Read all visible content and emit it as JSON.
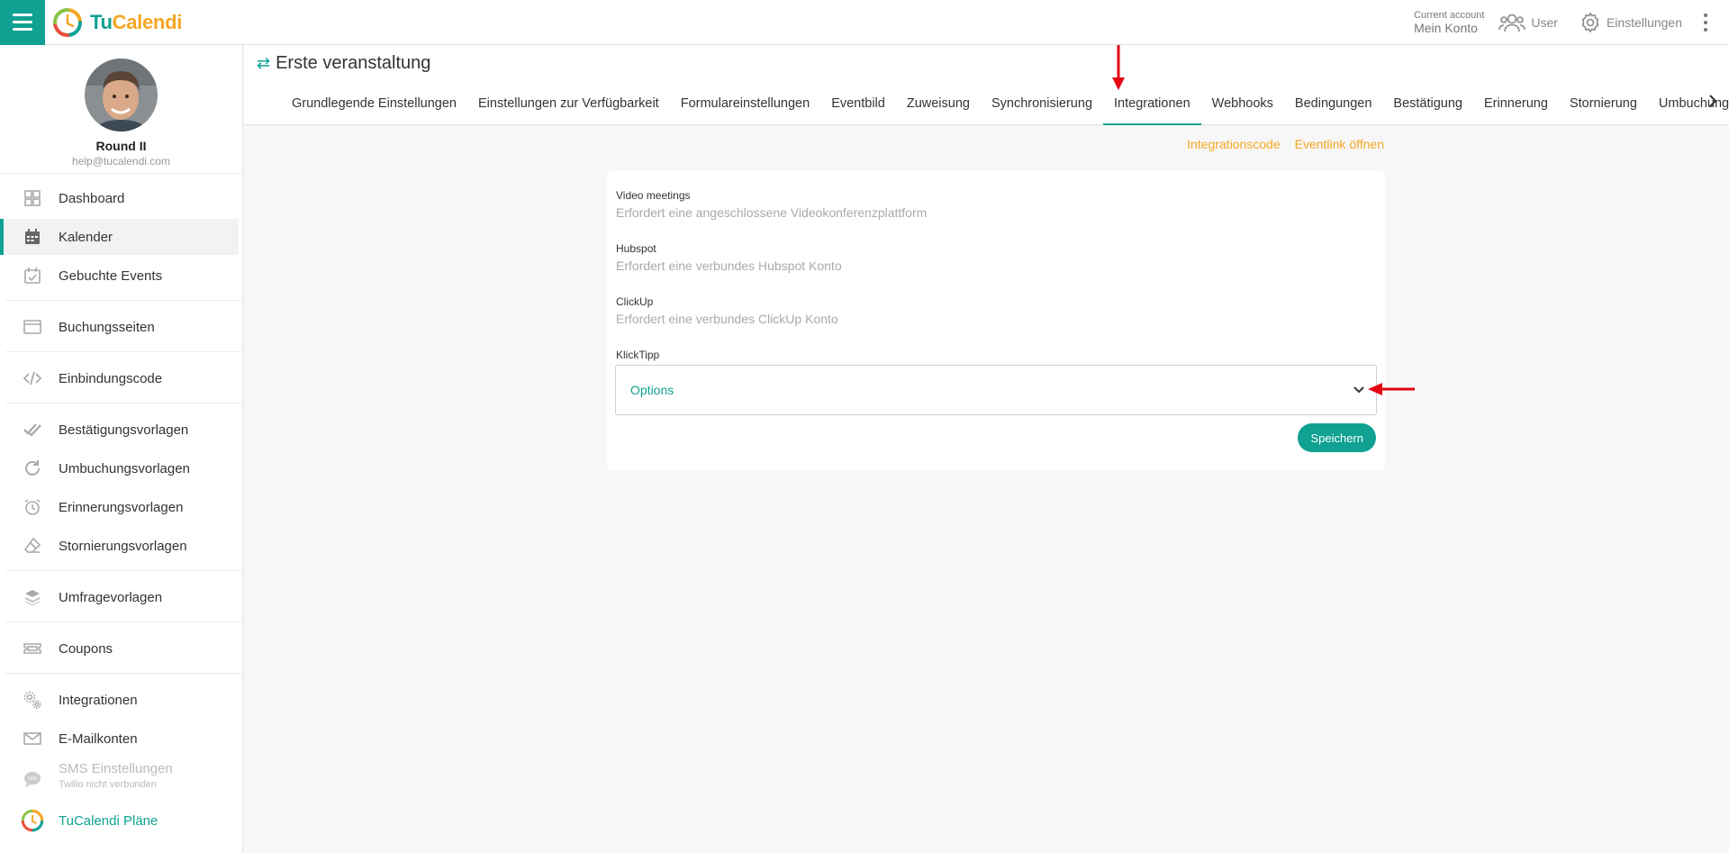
{
  "brand": {
    "name_part1": "Tu",
    "name_part2": "Calendi",
    "accent_color": "#10a192",
    "secondary_color": "#f5a623"
  },
  "topbar": {
    "account_small": "Current account",
    "account_main": "Mein Konto",
    "user_label": "User",
    "settings_label": "Einstellungen"
  },
  "profile": {
    "name": "Round II",
    "email": "help@tucalendi.com"
  },
  "sidebar": {
    "items": [
      {
        "label": "Dashboard",
        "icon": "grid-icon"
      },
      {
        "label": "Kalender",
        "icon": "calendar-icon"
      },
      {
        "label": "Gebuchte Events",
        "icon": "calendar-check-icon"
      },
      {
        "label": "Buchungsseiten",
        "icon": "browser-window-icon"
      },
      {
        "label": "Einbindungscode",
        "icon": "code-icon"
      },
      {
        "label": "Bestätigungsvorlagen",
        "icon": "double-check-icon"
      },
      {
        "label": "Umbuchungsvorlagen",
        "icon": "refresh-icon"
      },
      {
        "label": "Erinnerungsvorlagen",
        "icon": "alarm-clock-icon"
      },
      {
        "label": "Stornierungsvorlagen",
        "icon": "eraser-icon"
      },
      {
        "label": "Umfragevorlagen",
        "icon": "layers-icon"
      },
      {
        "label": "Coupons",
        "icon": "ticket-icon"
      },
      {
        "label": "Integrationen",
        "icon": "gears-icon"
      },
      {
        "label": "E-Mailkonten",
        "icon": "envelope-icon"
      }
    ],
    "sms": {
      "label": "SMS Einstellungen",
      "sub": "Twilio nicht verbunden"
    },
    "plans": {
      "label": "TuCalendi Pläne"
    }
  },
  "header": {
    "title": "Erste veranstaltung",
    "tabs": [
      "Grundlegende Einstellungen",
      "Einstellungen zur Verfügbarkeit",
      "Formulareinstellungen",
      "Eventbild",
      "Zuweisung",
      "Synchronisierung",
      "Integrationen",
      "Webhooks",
      "Bedingungen",
      "Bestätigung",
      "Erinnerung",
      "Stornierung",
      "Umbuchung"
    ],
    "active_tab": "Integrationen"
  },
  "links": {
    "integration_code": "Integrationscode",
    "open_eventlink": "Eventlink öffnen"
  },
  "card": {
    "video": {
      "label": "Video meetings",
      "desc": "Erfordert eine angeschlossene Videokonferenzplattform"
    },
    "hubspot": {
      "label": "Hubspot",
      "desc": "Erfordert eine verbundes Hubspot Konto"
    },
    "clickup": {
      "label": "ClickUp",
      "desc": "Erfordert eine verbundes ClickUp Konto"
    },
    "klicktipp": {
      "label": "KlickTipp",
      "select_value": "Options"
    },
    "save_label": "Speichern"
  }
}
